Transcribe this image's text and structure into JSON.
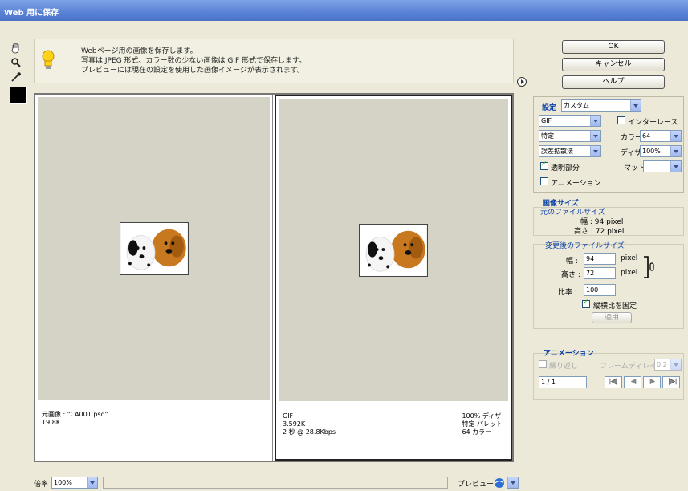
{
  "window": {
    "title": "Web 用に保存"
  },
  "tools": [
    "hand-tool",
    "zoom-tool",
    "eyedropper-tool"
  ],
  "info": {
    "lines": [
      "Webページ用の画像を保存します。",
      "写真は JPEG 形式、カラー数の少ない画像は GIF 形式で保存します。",
      "プレビューには現在の設定を使用した画像イメージが表示されます。"
    ]
  },
  "preview_left": {
    "meta_line1": "元画像 : \"CA001.psd\"",
    "meta_line2": "19.8K"
  },
  "preview_right": {
    "meta_left": [
      "GIF",
      "3.592K",
      "2 秒 @ 28.8Kbps"
    ],
    "meta_right": [
      "100% ディザ",
      "特定 パレット",
      "64 カラー"
    ]
  },
  "buttons": {
    "ok": "OK",
    "cancel": "キャンセル",
    "help": "ヘルプ"
  },
  "settings": {
    "label": "設定",
    "preset": "カスタム",
    "format": "GIF",
    "reduction": "特定",
    "dither_algo": "誤差拡散法",
    "interlace_label": "インターレース",
    "colors_label": "カラー",
    "colors_value": "64",
    "dither_label": "ディザ",
    "dither_value": "100%",
    "transparency_label": "透明部分",
    "matte_label": "マット",
    "animation_label": "アニメーション"
  },
  "image_size": {
    "header": "画像サイズ",
    "original_header": "元のファイルサイズ",
    "width_text": "幅 : 94 pixel",
    "height_text": "高さ : 72 pixel",
    "new_header": "変更後のファイルサイズ",
    "width_label": "幅 :",
    "width_value": "94",
    "height_label": "高さ :",
    "height_value": "72",
    "unit": "pixel",
    "percent_label": "比率 :",
    "percent_value": "100",
    "constrain_label": "縦横比を固定",
    "apply_label": "適用"
  },
  "animation": {
    "header": "アニメーション",
    "loop_label": "繰り返し",
    "frame_delay_label": "フレームディレイ",
    "frame_delay_value": "0.2",
    "frame_counter": "1 / 1",
    "nav": [
      "first-frame",
      "prev-frame",
      "next-frame",
      "last-frame"
    ]
  },
  "bottom": {
    "zoom_label": "倍率",
    "zoom_value": "100%",
    "preview_label": "プレビュー"
  },
  "colors": {
    "titlebar": "#5a82d6",
    "accent": "#0a3fa6",
    "canvas": "#d5d2c6"
  }
}
